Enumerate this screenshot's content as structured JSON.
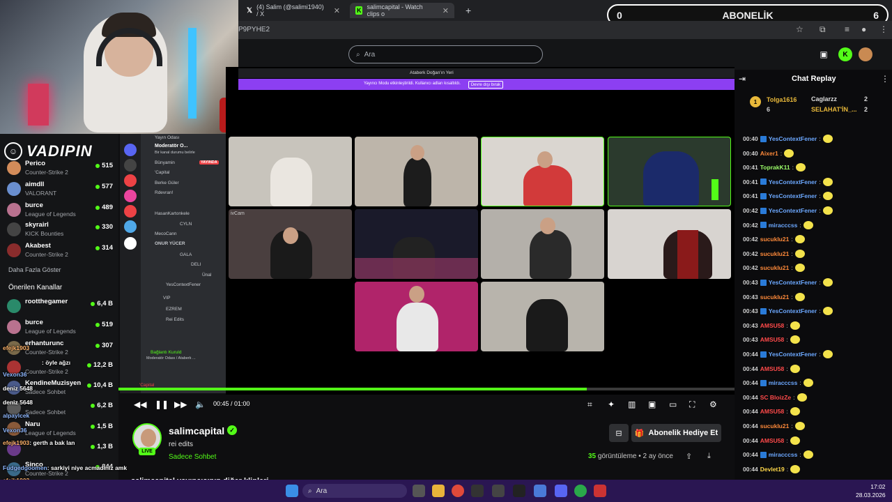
{
  "browser": {
    "tabs": [
      {
        "label": "(4) Salim (@salimi1940) / X"
      },
      {
        "label": "salimcapital - Watch clips o"
      }
    ],
    "url_fragment": "P9PYHE2",
    "subscription_overlay": {
      "left": "0",
      "label": "ABONELİK",
      "right": "6"
    }
  },
  "site": {
    "search_placeholder": "Ara"
  },
  "sidebar": {
    "brand": "VADIPIN",
    "following": [
      {
        "name": "Perico",
        "game": "Counter-Strike 2",
        "viewers": "515",
        "color": "#d38c5a"
      },
      {
        "name": "aimdll",
        "game": "VALORANT",
        "viewers": "577",
        "color": "#6a8fcf"
      },
      {
        "name": "burce",
        "game": "League of Legends",
        "viewers": "489",
        "color": "#b9728f"
      },
      {
        "name": "skyrairl",
        "game": "KICK Bounties",
        "viewers": "330",
        "color": "#444"
      },
      {
        "name": "Akabest",
        "game": "Counter-Strike 2",
        "viewers": "314",
        "color": "#8a2c2c"
      }
    ],
    "show_more": "Daha Fazla Göster",
    "recommended_title": "Önerilen Kanallar",
    "recommended": [
      {
        "name": "rootthegamer",
        "game": "",
        "viewers": "6,4 B",
        "color": "#2a8a6a"
      },
      {
        "name": "burce",
        "game": "League of Legends",
        "viewers": "519",
        "color": "#b9728f"
      },
      {
        "name": "erhanturunc",
        "game": "Counter-Strike 2",
        "viewers": "307",
        "color": "#7a6a4a"
      },
      {
        "name": "",
        "game": "Counter-Strike 2",
        "viewers": "12,2 B",
        "color": "#aa3333"
      },
      {
        "name": "KendineMuzisyen",
        "game": "Sadece Sohbet",
        "viewers": "10,4 B",
        "color": "#4a5a8a"
      },
      {
        "name": "",
        "game": "Sadece Sohbet",
        "viewers": "6,2 B",
        "color": "#5a5a5a"
      },
      {
        "name": "Naru",
        "game": "League of Legends",
        "viewers": "1,5 B",
        "color": "#8a5a3a"
      },
      {
        "name": "",
        "game": "",
        "viewers": "1,3 B",
        "color": "#6a3a8a"
      },
      {
        "name": "Sinco",
        "game": "Counter-Strike 2",
        "viewers": "844",
        "color": "#3a6a8a"
      }
    ]
  },
  "overlay_chat": [
    {
      "user": "efejk1903",
      "text": ""
    },
    {
      "user": "",
      "text": ": öyle ağzı"
    },
    {
      "user": "Vexon36",
      "text": ""
    },
    {
      "user": "deniz",
      "text": "5648"
    },
    {
      "user": "deniz",
      "text": "5648"
    },
    {
      "user": "alpaylcek",
      "text": ""
    },
    {
      "user": "Vexon36",
      "text": ""
    },
    {
      "user": "efejk1903",
      "text": ": gerth a bak lan"
    },
    {
      "user": "",
      "text": ""
    },
    {
      "user": "Fudgedgoomen",
      "text": ": sarkiyi niye acmadiniz amk"
    },
    {
      "user": "efejk1903",
      "text": ""
    },
    {
      "user": "efejk1903",
      "text": ""
    }
  ],
  "discord": {
    "window_title": "Ataberk Doğan'ın Yeri",
    "banner": "Yayıncı Modu etkinleştirildi. Kullanıcı adları kısaltıldı.",
    "banner_button": "Devre dışı bırak",
    "channels": [
      {
        "label": "Yayın Odası"
      },
      {
        "label": "Moderatör O..."
      },
      {
        "label": "Bir kanal durumu belirle"
      },
      {
        "label": "Bünyamin"
      },
      {
        "label": "YAYINDA"
      },
      {
        "label": "'Capital"
      },
      {
        "label": "Berke Güler"
      },
      {
        "label": "Rdevran!"
      },
      {
        "label": "HasanKartonkele"
      },
      {
        "label": "CYLN"
      },
      {
        "label": "MecoCann"
      },
      {
        "label": "ONUR YÜCER"
      },
      {
        "label": "GALA"
      },
      {
        "label": "DELI"
      },
      {
        "label": "Ünal"
      },
      {
        "label": "YesContextFener"
      },
      {
        "label": "VIP"
      },
      {
        "label": "EZREM"
      },
      {
        "label": "Rei Edits"
      },
      {
        "label": "Bağlantı Kuruld"
      },
      {
        "label": "Moderatör Odası / Ataberk ..."
      },
      {
        "label": "'Capital"
      }
    ],
    "camera_label": "ivCam"
  },
  "player": {
    "time": "00:45 / 01:00",
    "progress": 0.76
  },
  "channel": {
    "name": "salimcapital",
    "title": "rei edits",
    "category": "Sadece Sohbet",
    "live_badge": "LIVE",
    "more_title": "salimcapital yayıncısının diğer klipleri",
    "gift_button": "Abonelik Hediye Et",
    "views_count": "35",
    "views_label": "görüntüleme",
    "time_ago": "• 2 ay önce"
  },
  "chat": {
    "title": "Chat Replay",
    "leaderboard": [
      {
        "name": "Tolga1616",
        "count": "6"
      },
      {
        "name": "Caglarzz",
        "count": "2"
      },
      {
        "name": "SELAHAT'İN_...",
        "count": "2"
      }
    ],
    "messages": [
      {
        "time": "00:40",
        "user": "YesContextFener",
        "color": "#6ca8ff"
      },
      {
        "time": "00:40",
        "user": "Aixer1",
        "color": "#ff8a3a"
      },
      {
        "time": "00:41",
        "user": "ToprakK11",
        "color": "#9dff6a"
      },
      {
        "time": "00:41",
        "user": "YesContextFener",
        "color": "#6ca8ff"
      },
      {
        "time": "00:41",
        "user": "YesContextFener",
        "color": "#6ca8ff"
      },
      {
        "time": "00:42",
        "user": "YesContextFener",
        "color": "#6ca8ff"
      },
      {
        "time": "00:42",
        "user": "miracccss",
        "color": "#6ca8ff"
      },
      {
        "time": "00:42",
        "user": "sucuklu21",
        "color": "#ff8a3a"
      },
      {
        "time": "00:42",
        "user": "sucuklu21",
        "color": "#ff8a3a"
      },
      {
        "time": "00:42",
        "user": "sucuklu21",
        "color": "#ff8a3a"
      },
      {
        "time": "00:43",
        "user": "YesContextFener",
        "color": "#6ca8ff"
      },
      {
        "time": "00:43",
        "user": "sucuklu21",
        "color": "#ff8a3a"
      },
      {
        "time": "00:43",
        "user": "YesContextFener",
        "color": "#6ca8ff"
      },
      {
        "time": "00:43",
        "user": "AMSU58",
        "color": "#ff4a4a"
      },
      {
        "time": "00:43",
        "user": "AMSU58",
        "color": "#ff4a4a"
      },
      {
        "time": "00:44",
        "user": "YesContextFener",
        "color": "#6ca8ff"
      },
      {
        "time": "00:44",
        "user": "AMSU58",
        "color": "#ff4a4a"
      },
      {
        "time": "00:44",
        "user": "miracccss",
        "color": "#6ca8ff"
      },
      {
        "time": "00:44",
        "user": "SC BloizZe",
        "color": "#ff4a4a"
      },
      {
        "time": "00:44",
        "user": "AMSU58",
        "color": "#ff4a4a"
      },
      {
        "time": "00:44",
        "user": "sucuklu21",
        "color": "#ff8a3a"
      },
      {
        "time": "00:44",
        "user": "AMSU58",
        "color": "#ff4a4a"
      },
      {
        "time": "00:44",
        "user": "miracccss",
        "color": "#6ca8ff"
      },
      {
        "time": "00:44",
        "user": "Devlet19",
        "color": "#ffd84a"
      }
    ]
  },
  "taskbar": {
    "search_placeholder": "Ara",
    "time": "17:02",
    "date": "28.03.2026"
  }
}
